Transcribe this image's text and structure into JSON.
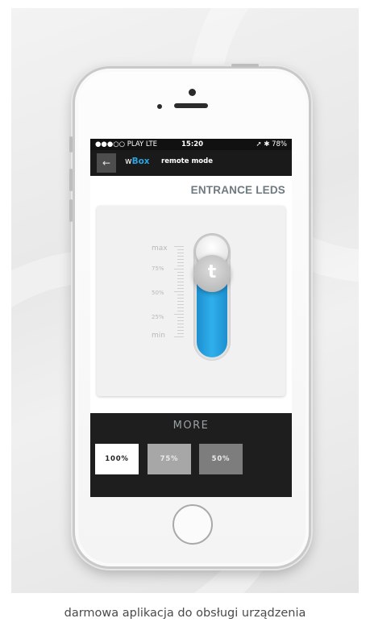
{
  "status_bar": {
    "carrier": "●●●○○ PLAY  LTE",
    "time": "15:20",
    "battery": "➚ ✱ 78%"
  },
  "nav": {
    "back_icon": "←",
    "brand_w": "w",
    "brand_box": "Box",
    "mode": "remote mode"
  },
  "main": {
    "title": "ENTRANCE LEDS",
    "scale": {
      "max": "max",
      "p75": "75%",
      "p50": "50%",
      "p25": "25%",
      "min": "min"
    },
    "slider_level": 0.75,
    "knob_logo": "t"
  },
  "bottom": {
    "more_label": "MORE",
    "presets": [
      "100%",
      "75%",
      "50%"
    ]
  },
  "caption": "darmowa aplikacja do obsługi urządzenia",
  "colors": {
    "accent": "#2ba4e0",
    "bar": "#1a1a1a"
  }
}
